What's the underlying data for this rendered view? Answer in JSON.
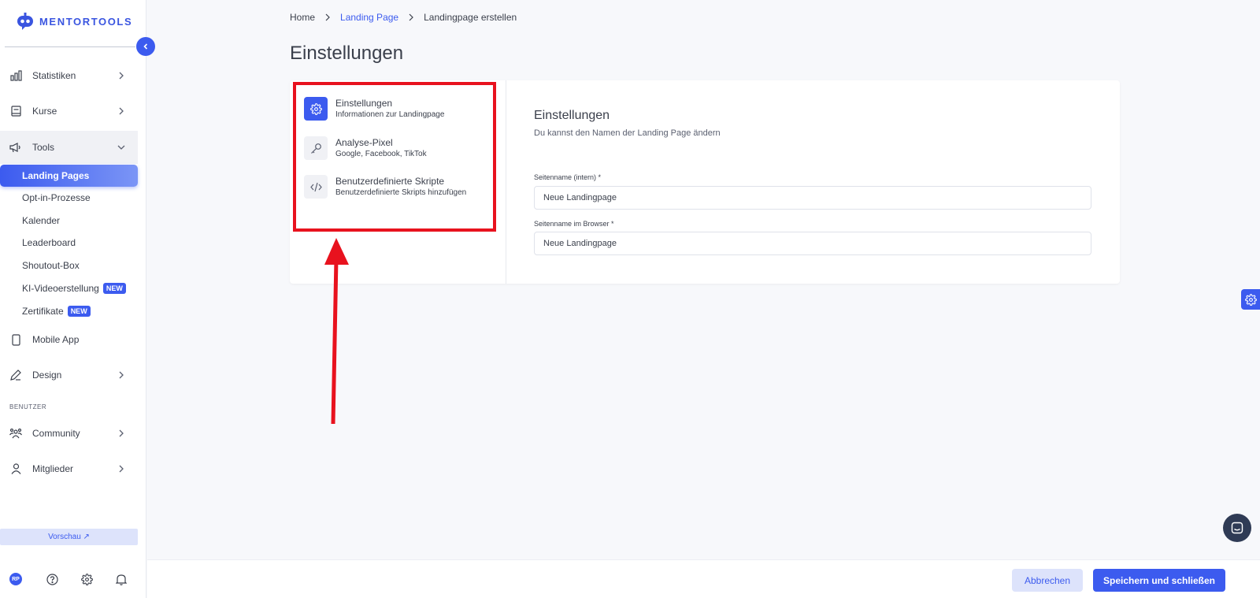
{
  "brand": {
    "name": "MENTORTOOLS",
    "accent": "#3c5bef"
  },
  "sidebar": {
    "items": [
      {
        "label": "Statistiken",
        "icon": "bar-chart-icon"
      },
      {
        "label": "Kurse",
        "icon": "book-icon"
      },
      {
        "label": "Tools",
        "icon": "megaphone-icon"
      },
      {
        "label": "Mobile App",
        "icon": "phone-icon"
      },
      {
        "label": "Design",
        "icon": "pencil-icon"
      },
      {
        "label": "Community",
        "icon": "people-icon"
      },
      {
        "label": "Mitglieder",
        "icon": "user-icon"
      }
    ],
    "tools_sub": [
      {
        "label": "Landing Pages",
        "active": true
      },
      {
        "label": "Opt-in-Prozesse"
      },
      {
        "label": "Kalender"
      },
      {
        "label": "Leaderboard"
      },
      {
        "label": "Shoutout-Box"
      },
      {
        "label": "KI-Videoerstellung",
        "badge": "NEW"
      },
      {
        "label": "Zertifikate",
        "badge": "NEW"
      }
    ],
    "section_users": "BENUTZER",
    "preview": "Vorschau ↗",
    "avatar_initials": "RP"
  },
  "breadcrumb": {
    "home": "Home",
    "parent": "Landing Page",
    "current": "Landingpage erstellen"
  },
  "page_title": "Einstellungen",
  "settings_menu": [
    {
      "title": "Einstellungen",
      "subtitle": "Informationen zur Landingpage",
      "icon": "gear-icon",
      "active": true
    },
    {
      "title": "Analyse-Pixel",
      "subtitle": "Google, Facebook, TikTok",
      "icon": "key-icon"
    },
    {
      "title": "Benutzerdefinierte Skripte",
      "subtitle": "Benutzerdefinierte Skripts hinzufügen",
      "icon": "code-icon"
    }
  ],
  "form": {
    "title": "Einstellungen",
    "description": "Du kannst den Namen der Landing Page ändern",
    "fields": [
      {
        "label": "Seitenname (intern) *",
        "value": "Neue Landingpage"
      },
      {
        "label": "Seitenname im Browser *",
        "value": "Neue Landingpage"
      }
    ]
  },
  "footer": {
    "cancel": "Abbrechen",
    "save": "Speichern und schließen"
  }
}
